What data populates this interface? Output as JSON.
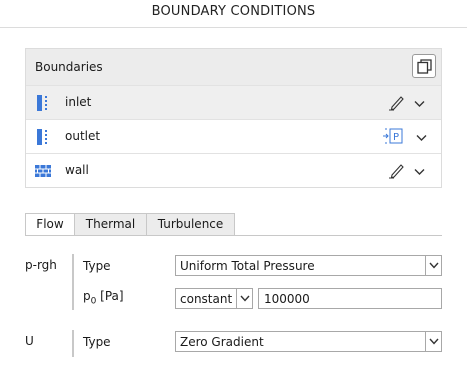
{
  "header": {
    "title": "BOUNDARY CONDITIONS"
  },
  "boundaries": {
    "label": "Boundaries",
    "items": [
      {
        "name": "inlet",
        "icon": "patch-icon",
        "action": "edit-pencil-icon",
        "selected": true
      },
      {
        "name": "outlet",
        "icon": "patch-icon",
        "action": "pressure-p-icon",
        "selected": false
      },
      {
        "name": "wall",
        "icon": "wall-icon",
        "action": "edit-pencil-icon",
        "selected": false
      }
    ]
  },
  "tabs": [
    {
      "label": "Flow",
      "active": true
    },
    {
      "label": "Thermal",
      "active": false
    },
    {
      "label": "Turbulence",
      "active": false
    }
  ],
  "flow": {
    "p_rgh": {
      "label": "p-rgh",
      "type_label": "Type",
      "type_value": "Uniform Total Pressure",
      "p0_label_main": "p",
      "p0_label_sub": "0",
      "p0_label_unit": " [Pa]",
      "p0_mode": "constant",
      "p0_value": "100000"
    },
    "U": {
      "label": "U",
      "type_label": "Type",
      "type_value": "Zero Gradient"
    }
  },
  "colors": {
    "accent_blue": "#3b78d8",
    "header_bg": "#ececec",
    "border": "#dcdcdc"
  }
}
